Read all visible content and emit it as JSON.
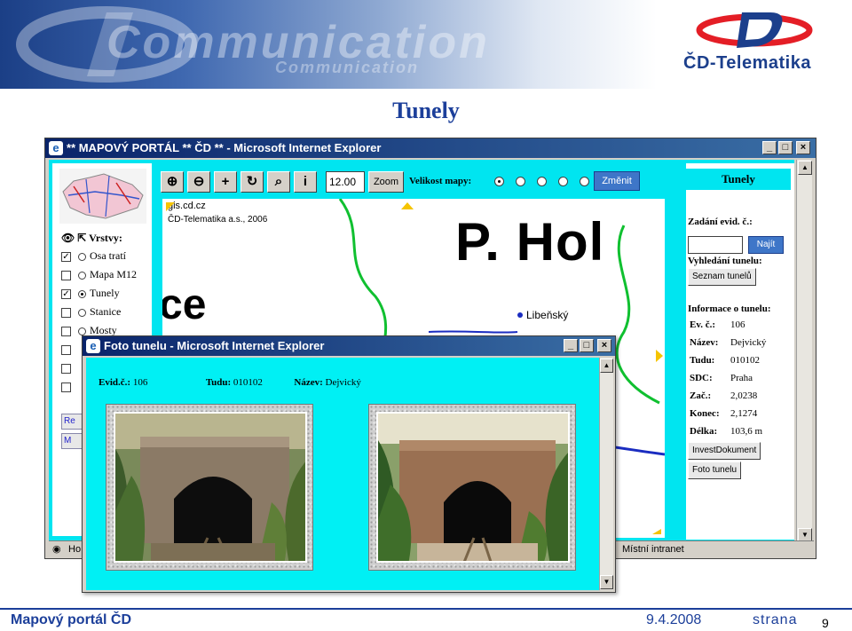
{
  "header": {
    "banner_text": "Communication",
    "banner_subtext": "Communication",
    "logo_text": "ČD-Telematika",
    "accent_color": "#1c3f9a",
    "logo_red": "#e41e26"
  },
  "slide_title": "Tunely",
  "main_window": {
    "title": "** MAPOVÝ PORTÁL ** ČD ** - Microsoft Internet Explorer",
    "status_left": "Ho",
    "status_right": "Místní intranet",
    "layers": {
      "heading": "Vrstvy:",
      "items": [
        {
          "label": "Osa tratí",
          "checked": true,
          "radio": false
        },
        {
          "label": "Mapa M12",
          "checked": false,
          "radio": false
        },
        {
          "label": "Tunely",
          "checked": true,
          "radio": true
        },
        {
          "label": "Stanice",
          "checked": false,
          "radio": false
        },
        {
          "label": "Mosty",
          "checked": false,
          "radio": false
        }
      ],
      "btn1": "Re",
      "btn2": "M"
    },
    "toolbar": {
      "zoom_value": "12.00",
      "zoom_label": "Zoom",
      "map_size_label": "Velikost mapy:",
      "change_label": "Změnit"
    },
    "map": {
      "host": "gis.cd.cz",
      "copyright": "ČD-Telematika a.s., 2006",
      "big_text": "P. Hol",
      "partial_text": "ce",
      "place": "Libeňský"
    },
    "info_panel": {
      "title": "Tunely",
      "evid_label": "Zadání evid. č.:",
      "find_label": "Najít",
      "search_label": "Vyhledání tunelu:",
      "list_button": "Seznam tunelů",
      "info_label": "Informace o tunelu:",
      "fields": [
        {
          "key": "Ev. č.:",
          "value": "106"
        },
        {
          "key": "Název:",
          "value": "Dejvický"
        },
        {
          "key": "Tudu:",
          "value": "010102"
        },
        {
          "key": "SDC:",
          "value": "Praha"
        },
        {
          "key": "Zač.:",
          "value": "2,0238"
        },
        {
          "key": "Konec:",
          "value": "2,1274"
        },
        {
          "key": "Délka:",
          "value": "103,6 m"
        }
      ],
      "invest_button": "InvestDokument",
      "photo_button": "Foto tunelu"
    }
  },
  "photo_window": {
    "title": "Foto tunelu - Microsoft Internet Explorer",
    "evid_key": "Evid.č.:",
    "evid_value": "106",
    "tudu_key": "Tudu:",
    "tudu_value": "010102",
    "name_key": "Název:",
    "name_value": "Dejvický"
  },
  "footer": {
    "left": "Mapový portál ČD",
    "date": "9.4.2008",
    "page_label": "strana",
    "page_number": "9"
  }
}
